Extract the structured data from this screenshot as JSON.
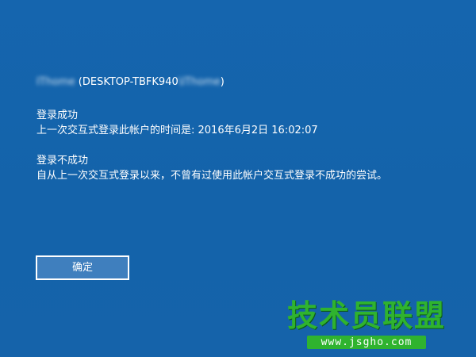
{
  "account": {
    "user_prefix": "IThome",
    "machine": " (DESKTOP-TBFK940",
    "user_suffix": "\\IThome",
    "close_paren": ")"
  },
  "success": {
    "title": "登录成功",
    "detail": "上一次交互式登录此帐户的时间是: 2016年6月2日 16:02:07"
  },
  "failure": {
    "title": "登录不成功",
    "detail": "自从上一次交互式登录以来，不曾有过使用此帐户交互式登录不成功的尝试。"
  },
  "buttons": {
    "ok_label": "确定"
  },
  "watermark": {
    "title": "技术员联盟",
    "url": "www.jsgho.com"
  },
  "colors": {
    "background": "#1464ac",
    "button_fill": "#3f7fbe",
    "watermark_green": "#2fb32f"
  }
}
